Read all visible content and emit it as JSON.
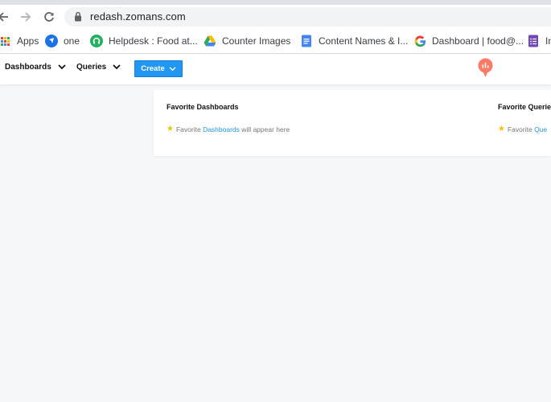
{
  "browser": {
    "url": "redash.zomans.com",
    "bookmarks": [
      {
        "label": "Apps",
        "icon": "apps-grid-icon"
      },
      {
        "label": "one",
        "icon": "bookmark-blue-icon"
      },
      {
        "label": "Helpdesk : Food at...",
        "icon": "headset-icon"
      },
      {
        "label": "Counter Images",
        "icon": "google-drive-icon"
      },
      {
        "label": "Content Names & I...",
        "icon": "google-docs-icon"
      },
      {
        "label": "Dashboard | food@...",
        "icon": "google-g-icon"
      },
      {
        "label": "In",
        "icon": "google-forms-icon"
      }
    ]
  },
  "header": {
    "dashboards_label": "Dashboards",
    "queries_label": "Queries",
    "create_label": "Create"
  },
  "favorites": {
    "dashboards": {
      "title": "Favorite Dashboards",
      "prefix": "Favorite",
      "link": "Dashboards",
      "suffix": "will appear here"
    },
    "queries": {
      "title": "Favorite Querie",
      "prefix": "Favorite",
      "link": "Que"
    }
  },
  "colors": {
    "accent": "#2196f3",
    "star": "#f5c000",
    "logo": "#ff7964",
    "page_bg": "#f6f7f9"
  }
}
